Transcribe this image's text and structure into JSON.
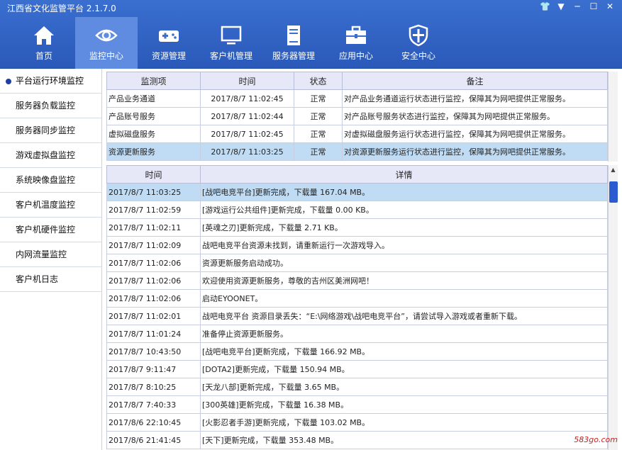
{
  "window": {
    "title": "江西省文化监管平台 2.1.7.0"
  },
  "nav": [
    {
      "label": "首页",
      "icon": "home-icon"
    },
    {
      "label": "监控中心",
      "icon": "eye-icon",
      "active": true
    },
    {
      "label": "资源管理",
      "icon": "gamepad-icon"
    },
    {
      "label": "客户机管理",
      "icon": "monitor-icon"
    },
    {
      "label": "服务器管理",
      "icon": "server-icon"
    },
    {
      "label": "应用中心",
      "icon": "toolbox-icon"
    },
    {
      "label": "安全中心",
      "icon": "shield-icon"
    }
  ],
  "sidebar": {
    "items": [
      "平台运行环境监控",
      "服务器负载监控",
      "服务器同步监控",
      "游戏虚拟盘监控",
      "系统映像盘监控",
      "客户机温度监控",
      "客户机硬件监控",
      "内网流量监控",
      "客户机日志"
    ]
  },
  "status_table": {
    "headers": [
      "监测项",
      "时间",
      "状态",
      "备注"
    ],
    "rows": [
      [
        "产品业务通道",
        "2017/8/7 11:02:45",
        "正常",
        "对产品业务通道运行状态进行监控，保障其为网吧提供正常服务。"
      ],
      [
        "产品账号服务",
        "2017/8/7 11:02:44",
        "正常",
        "对产品账号服务状态进行监控，保障其为网吧提供正常服务。"
      ],
      [
        "虚拟磁盘服务",
        "2017/8/7 11:02:45",
        "正常",
        "对虚拟磁盘服务运行状态进行监控，保障其为网吧提供正常服务。"
      ],
      [
        "资源更新服务",
        "2017/8/7 11:03:25",
        "正常",
        "对资源更新服务运行状态进行监控，保障其为网吧提供正常服务。"
      ]
    ]
  },
  "log_table": {
    "headers": [
      "时间",
      "详情"
    ],
    "rows": [
      [
        "2017/8/7 11:03:25",
        "[战吧电竞平台]更新完成，下载量 167.04 MB。"
      ],
      [
        "2017/8/7 11:02:59",
        "[游戏运行公共组件]更新完成，下载量 0.00 KB。"
      ],
      [
        "2017/8/7 11:02:11",
        "[英魂之刃]更新完成，下载量 2.71 KB。"
      ],
      [
        "2017/8/7 11:02:09",
        "战吧电竞平台资源未找到，请重新运行一次游戏导入。"
      ],
      [
        "2017/8/7 11:02:06",
        "资源更新服务启动成功。"
      ],
      [
        "2017/8/7 11:02:06",
        "欢迎使用资源更新服务，尊敬的吉州区美洲网吧！"
      ],
      [
        "2017/8/7 11:02:06",
        "启动EYOONET。"
      ],
      [
        "2017/8/7 11:02:01",
        "战吧电竞平台 资源目录丢失：“E:\\网络游戏\\战吧电竞平台”，请尝试导入游戏或者重新下载。"
      ],
      [
        "2017/8/7 11:01:24",
        "准备停止资源更新服务。"
      ],
      [
        "2017/8/7 10:43:50",
        "[战吧电竞平台]更新完成，下载量 166.92 MB。"
      ],
      [
        "2017/8/7 9:11:47",
        "[DOTA2]更新完成，下载量 150.94 MB。"
      ],
      [
        "2017/8/7 8:10:25",
        "[天龙八部]更新完成，下载量 3.65 MB。"
      ],
      [
        "2017/8/7 7:40:33",
        "[300英雄]更新完成，下载量 16.38 MB。"
      ],
      [
        "2017/8/6 22:10:45",
        "[火影忍者手游]更新完成，下载量 103.02 MB。"
      ],
      [
        "2017/8/6 21:41:45",
        "[天下]更新完成，下载量 353.48 MB。"
      ]
    ]
  },
  "watermark": "583go.com"
}
